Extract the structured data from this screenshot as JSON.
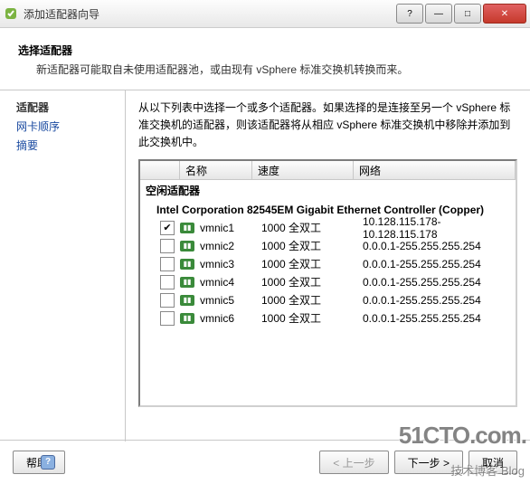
{
  "window": {
    "title": "添加适配器向导",
    "buttons": {
      "help": "?",
      "min": "—",
      "max": "□",
      "close": "✕"
    }
  },
  "header": {
    "title": "选择适配器",
    "desc": "新适配器可能取自未使用适配器池，或由现有 vSphere 标准交换机转换而来。"
  },
  "sidebar": {
    "items": [
      {
        "label": "适配器",
        "active": true
      },
      {
        "label": "网卡顺序"
      },
      {
        "label": "摘要"
      }
    ]
  },
  "main": {
    "instructions": "从以下列表中选择一个或多个适配器。如果选择的是连接至另一个 vSphere 标准交换机的适配器，则该适配器将从相应 vSphere 标准交换机中移除并添加到此交换机中。",
    "columns": {
      "c0": "",
      "c1": "名称",
      "c2": "速度",
      "c3": "网络"
    },
    "group": "空闲适配器",
    "subgroup": "Intel Corporation 82545EM Gigabit Ethernet Controller (Copper)",
    "rows": [
      {
        "checked": true,
        "name": "vmnic1",
        "speed": "1000 全双工",
        "network": "10.128.115.178-10.128.115.178"
      },
      {
        "checked": false,
        "name": "vmnic2",
        "speed": "1000 全双工",
        "network": "0.0.0.1-255.255.255.254"
      },
      {
        "checked": false,
        "name": "vmnic3",
        "speed": "1000 全双工",
        "network": "0.0.0.1-255.255.255.254"
      },
      {
        "checked": false,
        "name": "vmnic4",
        "speed": "1000 全双工",
        "network": "0.0.0.1-255.255.255.254"
      },
      {
        "checked": false,
        "name": "vmnic5",
        "speed": "1000 全双工",
        "network": "0.0.0.1-255.255.255.254"
      },
      {
        "checked": false,
        "name": "vmnic6",
        "speed": "1000 全双工",
        "network": "0.0.0.1-255.255.255.254"
      }
    ]
  },
  "footer": {
    "help": "帮助",
    "back": "< 上一步",
    "next": "下一步 >",
    "cancel": "取消"
  },
  "watermark": {
    "big": "51CTO.com.",
    "small": "技术博客 Blog"
  }
}
